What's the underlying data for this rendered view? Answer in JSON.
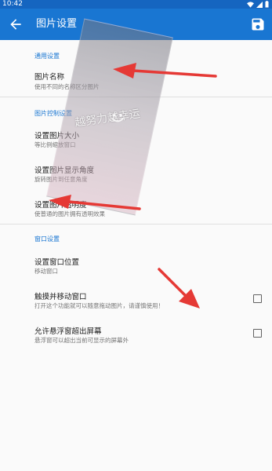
{
  "status": {
    "time": "10:42"
  },
  "appbar": {
    "title": "图片设置",
    "back_icon": "arrow-left-icon",
    "save_icon": "save-icon"
  },
  "sections": {
    "general": {
      "title": "通用设置",
      "items": [
        {
          "title": "图片名称",
          "summary": "使用不同的名称区分图片"
        }
      ]
    },
    "image": {
      "title": "图片控制设置",
      "items": [
        {
          "title": "设置图片大小",
          "summary": "等比例缩放窗口"
        },
        {
          "title": "设置图片显示角度",
          "summary": "旋转图片到任意角度"
        },
        {
          "title": "设置图片透明度",
          "summary": "使普通的图片拥有透明效果"
        }
      ]
    },
    "window": {
      "title": "窗口设置",
      "items": [
        {
          "title": "设置窗口位置",
          "summary": "移动窗口"
        },
        {
          "title": "触摸并移动窗口",
          "summary": "打开这个功能就可以随意拖动图片，请谨慎使用！",
          "checked": false
        },
        {
          "title": "允许悬浮窗超出屏幕",
          "summary": "悬浮窗可以超出当前可显示的屏幕外",
          "checked": false
        }
      ]
    }
  },
  "overlay": {
    "caption": "越努力越幸运"
  },
  "colors": {
    "primary": "#1976d2",
    "statusbar": "#1565c0",
    "arrow": "#e53935"
  }
}
